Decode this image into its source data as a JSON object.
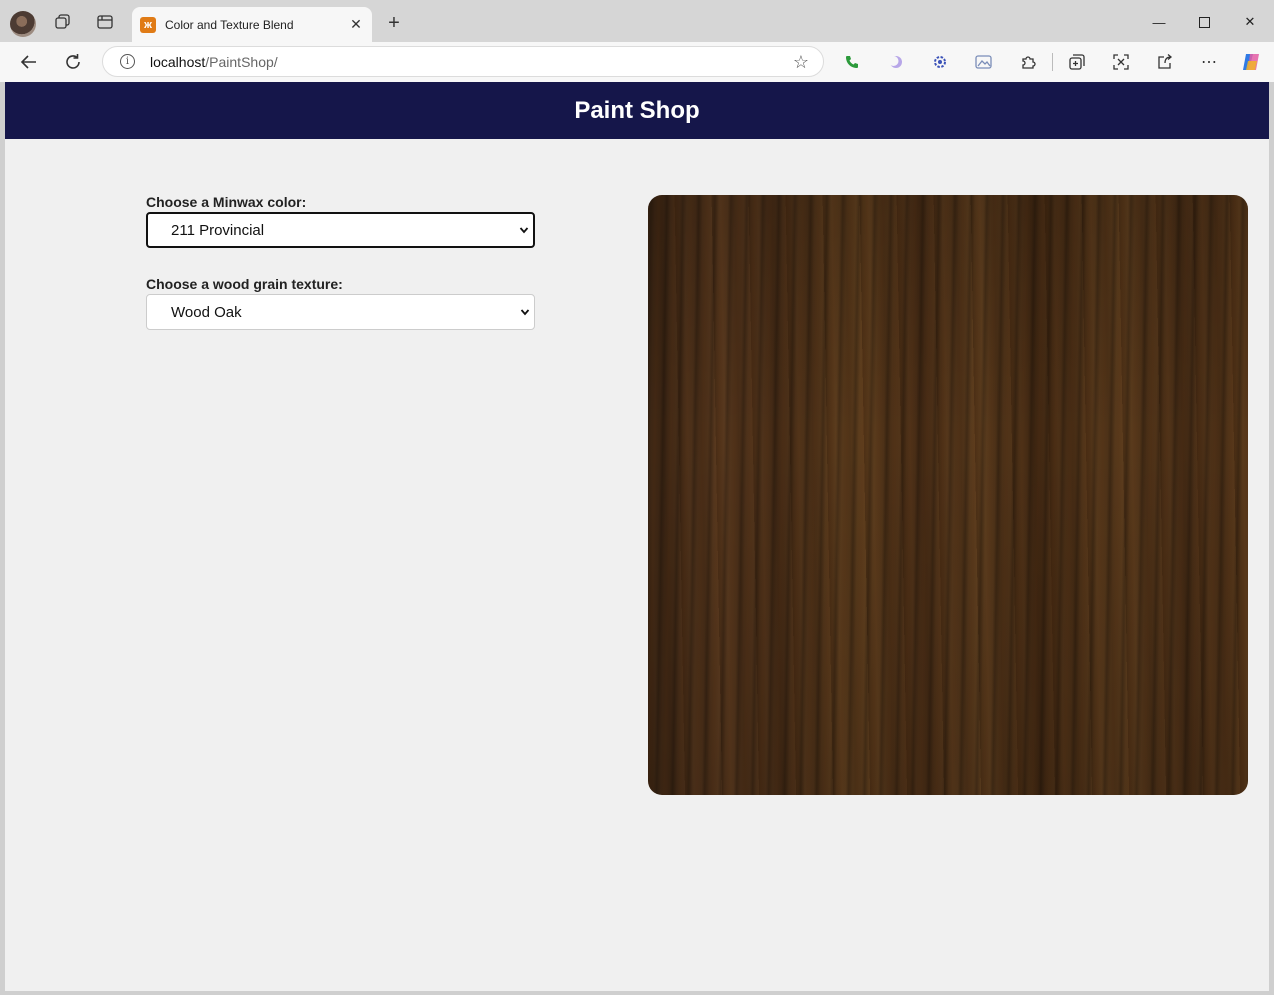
{
  "browser": {
    "tab_title": "Color and Texture Blend",
    "url_host": "localhost",
    "url_path": "/PaintShop/"
  },
  "page": {
    "title": "Paint Shop",
    "color_label": "Choose a Minwax color:",
    "color_value": "211 Provincial",
    "texture_label": "Choose a wood grain texture:",
    "texture_value": "Wood Oak"
  },
  "colors": {
    "header_bg": "#15164a",
    "page_bg": "#f0f0f0",
    "wood_base": "#5a3a1f"
  }
}
